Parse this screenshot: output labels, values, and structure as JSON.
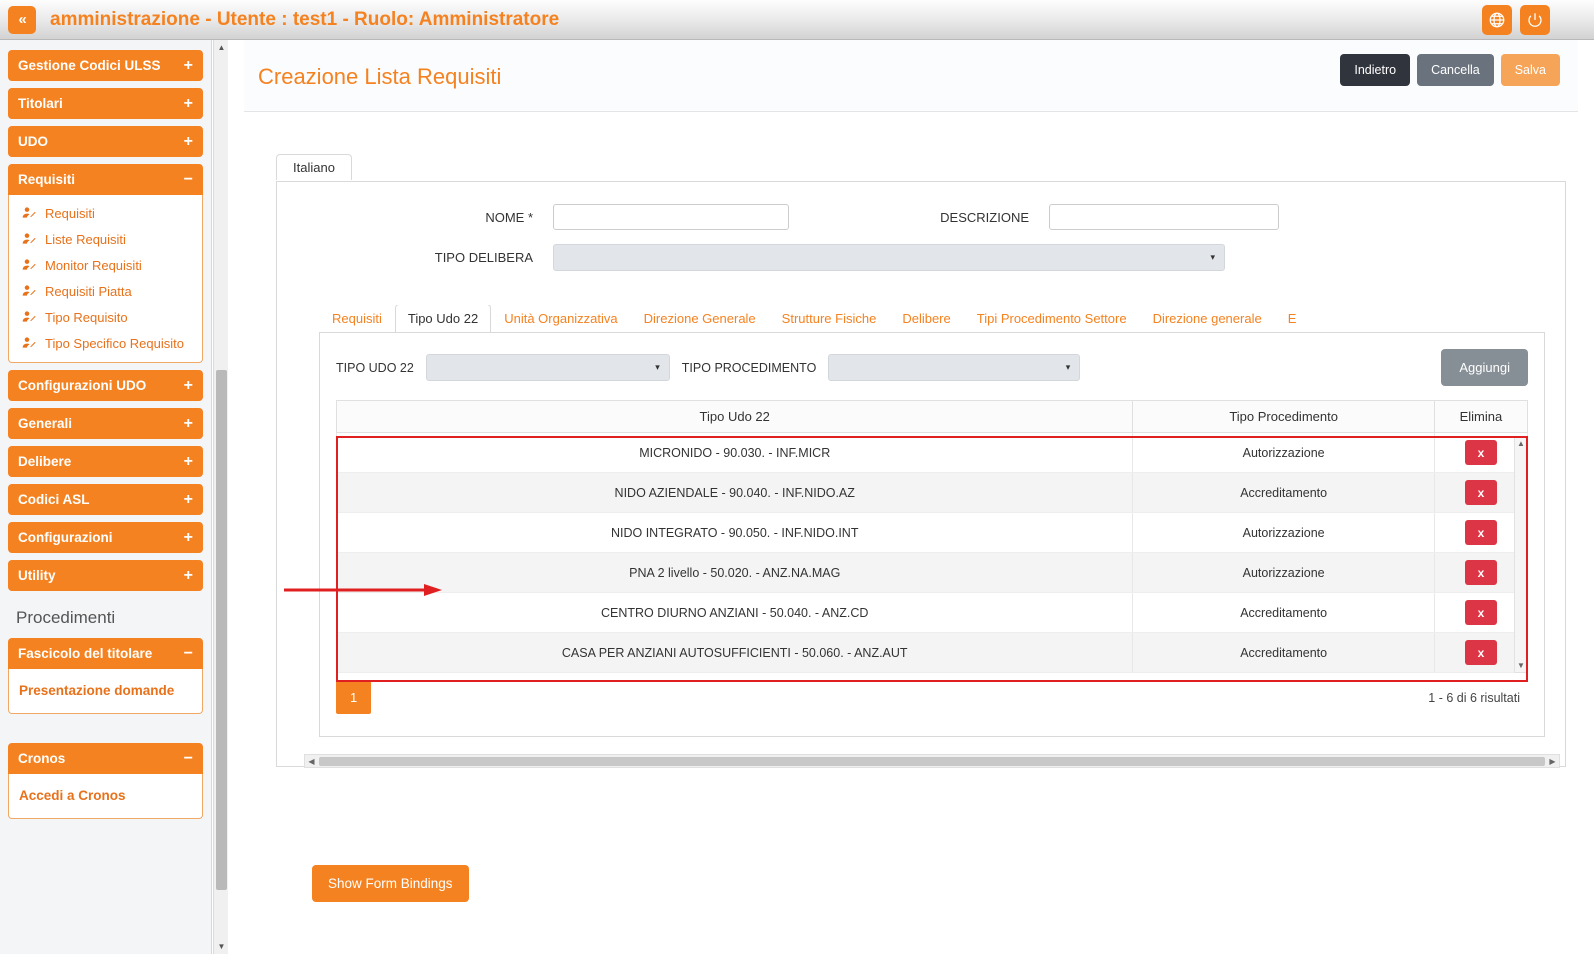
{
  "header": {
    "collapse_icon": "double-chevron-left-icon",
    "title": "amministrazione - Utente : test1 - Ruolo: Amministratore",
    "language_icon": "globe-icon",
    "logout_icon": "power-icon"
  },
  "sidebar": {
    "groups": [
      {
        "label": "Gestione Codici ULSS",
        "toggle": "+",
        "expanded": false
      },
      {
        "label": "Titolari",
        "toggle": "+",
        "expanded": false
      },
      {
        "label": "UDO",
        "toggle": "+",
        "expanded": false
      },
      {
        "label": "Requisiti",
        "toggle": "−",
        "expanded": true,
        "items": [
          {
            "label": "Requisiti",
            "icon": "user-edit-icon"
          },
          {
            "label": "Liste Requisiti",
            "icon": "user-edit-icon"
          },
          {
            "label": "Monitor Requisiti",
            "icon": "user-edit-icon"
          },
          {
            "label": "Requisiti Piatta",
            "icon": "user-edit-icon"
          },
          {
            "label": "Tipo Requisito",
            "icon": "user-edit-icon"
          },
          {
            "label": "Tipo Specifico Requisito",
            "icon": "user-edit-icon"
          }
        ]
      },
      {
        "label": "Configurazioni UDO",
        "toggle": "+",
        "expanded": false
      },
      {
        "label": "Generali",
        "toggle": "+",
        "expanded": false
      },
      {
        "label": "Delibere",
        "toggle": "+",
        "expanded": false
      },
      {
        "label": "Codici ASL",
        "toggle": "+",
        "expanded": false
      },
      {
        "label": "Configurazioni",
        "toggle": "+",
        "expanded": false
      },
      {
        "label": "Utility",
        "toggle": "+",
        "expanded": false
      }
    ],
    "section_label": "Procedimenti",
    "fascicolo": {
      "label": "Fascicolo del titolare",
      "toggle": "−",
      "item": "Presentazione domande"
    },
    "cronos": {
      "label": "Cronos",
      "toggle": "−",
      "item": "Accedi a Cronos"
    }
  },
  "page": {
    "title": "Creazione Lista Requisiti",
    "actions": {
      "back": "Indietro",
      "cancel": "Cancella",
      "save": "Salva"
    }
  },
  "form": {
    "lang_tab": "Italiano",
    "nome_label": "NOME *",
    "nome_value": "",
    "descrizione_label": "DESCRIZIONE",
    "descrizione_value": "",
    "tipo_delibera_label": "TIPO DELIBERA",
    "tipo_delibera_value": "",
    "dropdown_arrow": "▾"
  },
  "tabs": [
    {
      "label": "Requisiti",
      "active": false
    },
    {
      "label": "Tipo Udo 22",
      "active": true
    },
    {
      "label": "Unità Organizzativa",
      "active": false
    },
    {
      "label": "Direzione Generale",
      "active": false
    },
    {
      "label": "Strutture Fisiche",
      "active": false
    },
    {
      "label": "Delibere",
      "active": false
    },
    {
      "label": "Tipi Procedimento Settore",
      "active": false
    },
    {
      "label": "Direzione generale",
      "active": false
    },
    {
      "label": "E",
      "active": false
    }
  ],
  "filters": {
    "tipo_udo_label": "TIPO UDO 22",
    "tipo_udo_value": "",
    "tipo_procedimento_label": "TIPO PROCEDIMENTO",
    "tipo_procedimento_value": "",
    "add_button": "Aggiungi"
  },
  "table": {
    "columns": [
      "Tipo Udo 22",
      "Tipo Procedimento",
      "Elimina"
    ],
    "delete_glyph": "x",
    "rows": [
      {
        "tipo_udo": "MICRONIDO - 90.030. - INF.MICR",
        "tipo_procedimento": "Autorizzazione"
      },
      {
        "tipo_udo": "NIDO AZIENDALE - 90.040. - INF.NIDO.AZ",
        "tipo_procedimento": "Accreditamento"
      },
      {
        "tipo_udo": "NIDO INTEGRATO - 90.050. - INF.NIDO.INT",
        "tipo_procedimento": "Autorizzazione"
      },
      {
        "tipo_udo": "PNA 2 livello - 50.020. - ANZ.NA.MAG",
        "tipo_procedimento": "Autorizzazione"
      },
      {
        "tipo_udo": "CENTRO DIURNO ANZIANI - 50.040. - ANZ.CD",
        "tipo_procedimento": "Accreditamento"
      },
      {
        "tipo_udo": "CASA PER ANZIANI AUTOSUFFICIENTI - 50.060. - ANZ.AUT",
        "tipo_procedimento": "Accreditamento"
      }
    ]
  },
  "pagination": {
    "current_page": "1",
    "results_info": "1 - 6 di 6 risultati"
  },
  "footer": {
    "show_bindings": "Show Form Bindings"
  },
  "colors": {
    "accent": "#f58220",
    "danger": "#dc3545",
    "annotation": "#e02020",
    "dark_btn": "#30343c"
  }
}
